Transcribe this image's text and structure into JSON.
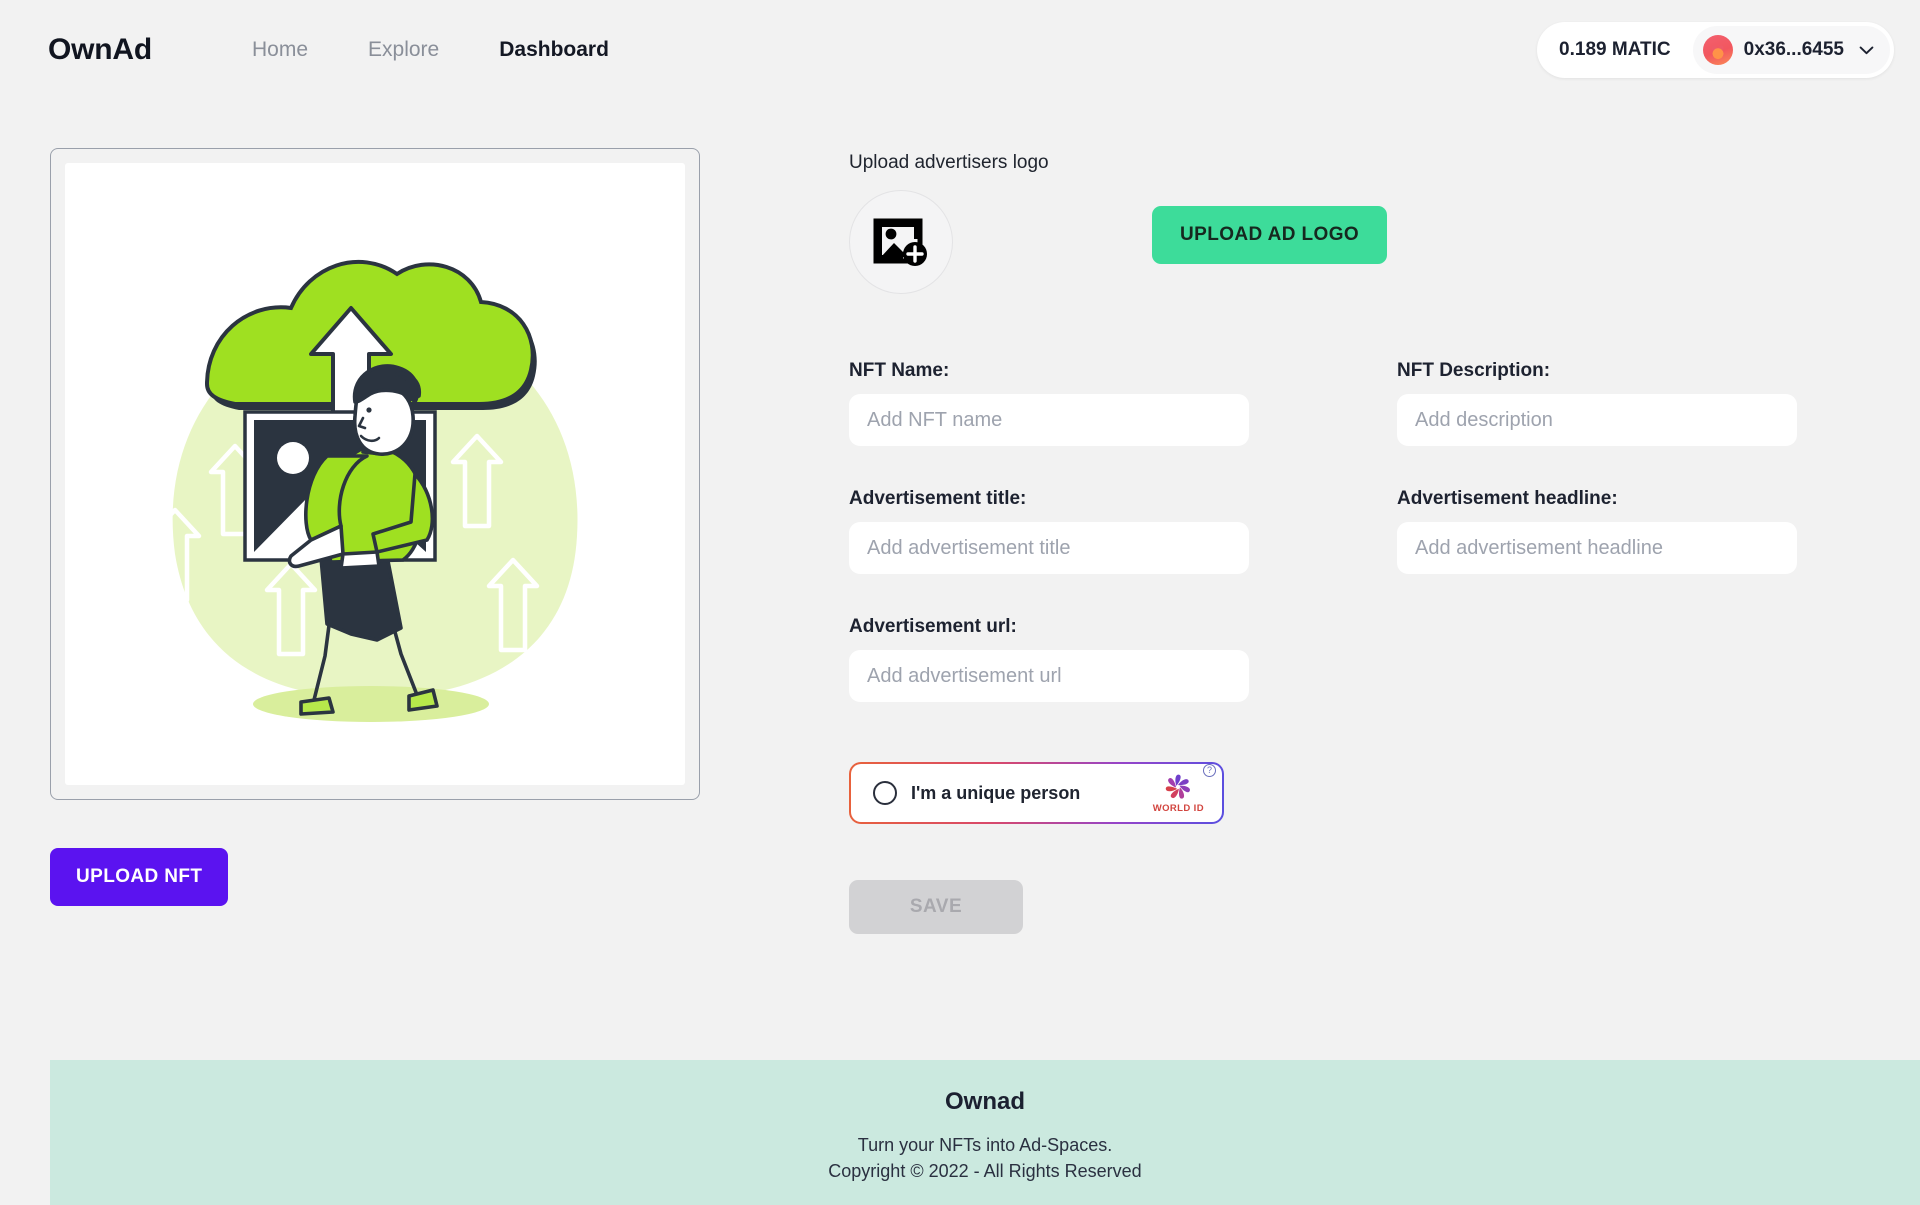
{
  "header": {
    "brand": "OwnAd",
    "nav": [
      {
        "label": "Home",
        "active": false
      },
      {
        "label": "Explore",
        "active": false
      },
      {
        "label": "Dashboard",
        "active": true
      }
    ],
    "wallet": {
      "balance": "0.189 MATIC",
      "address": "0x36...6455",
      "chevron_icon": "chevron-down-icon",
      "avatar_icon": "wallet-avatar-icon"
    }
  },
  "preview": {
    "illustration_name": "upload-image-illustration",
    "upload_nft_label": "UPLOAD NFT"
  },
  "form": {
    "logo_section_label": "Upload advertisers logo",
    "avatar_placeholder_icon": "add-photo-icon",
    "upload_logo_label": "UPLOAD AD LOGO",
    "fields": [
      {
        "label": "NFT Name:",
        "placeholder": "Add NFT name",
        "value": ""
      },
      {
        "label": "NFT Description:",
        "placeholder": "Add description",
        "value": ""
      },
      {
        "label": "Advertisement title:",
        "placeholder": "Add advertisement title",
        "value": ""
      },
      {
        "label": "Advertisement headline:",
        "placeholder": "Add advertisement headline",
        "value": ""
      },
      {
        "label": "Advertisement url:",
        "placeholder": "Add advertisement url",
        "value": ""
      }
    ],
    "worldid": {
      "text": "I'm a unique person",
      "brand": "WORLD ID",
      "help_icon": "question-mark-icon",
      "logo_icon": "world-id-logo-icon",
      "checked": false
    },
    "save_label": "SAVE",
    "save_disabled": true
  },
  "footer": {
    "title": "Ownad",
    "tagline": "Turn your NFTs into Ad-Spaces.",
    "copyright": "Copyright © 2022 - All Rights Reserved"
  },
  "colors": {
    "page_bg": "#f2f2f2",
    "upload_nft": "#5b13f0",
    "upload_logo": "#3ddc9a",
    "footer_bg": "#cbe9df",
    "save_disabled_bg": "#d2d2d4",
    "illustration_green": "#9fe021"
  }
}
